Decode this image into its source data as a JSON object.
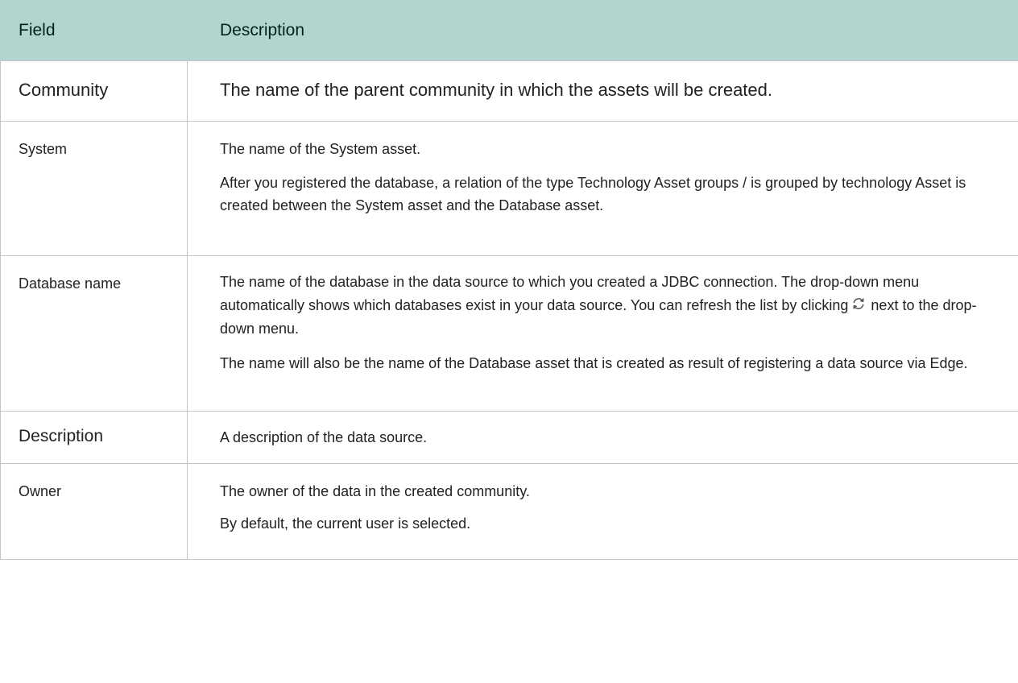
{
  "table": {
    "headers": {
      "field": "Field",
      "description": "Description"
    },
    "rows": {
      "community": {
        "field": "Community",
        "desc": "The name of the parent community in which the assets will be created."
      },
      "system": {
        "field": "System",
        "desc_p1": "The name of the System asset.",
        "desc_p2": "After you registered the database, a relation of the type Technology Asset groups / is grouped by technology Asset is created between the System asset and the Database asset."
      },
      "database_name": {
        "field": "Database name",
        "desc_p1_a": "The name of the database in the data source to which you created a JDBC connection. The drop-down menu automatically shows which databases exist in your data source. You can refresh the list by clicking",
        "desc_p1_icon": "refresh-icon",
        "desc_p1_b": "next to the drop-down menu.",
        "desc_p2": "The name will also be the name of the Database asset that is created as result of registering a data source via Edge."
      },
      "description": {
        "field": "Description",
        "desc": "A description of the data source."
      },
      "owner": {
        "field": "Owner",
        "desc_p1": "The owner of the data in the created community.",
        "desc_p2": "By default, the current user is selected."
      }
    }
  },
  "colors": {
    "header_bg": "#b1d6cf",
    "header_text": "#06211c",
    "border": "#c4c4c4",
    "body_text": "#222222"
  }
}
